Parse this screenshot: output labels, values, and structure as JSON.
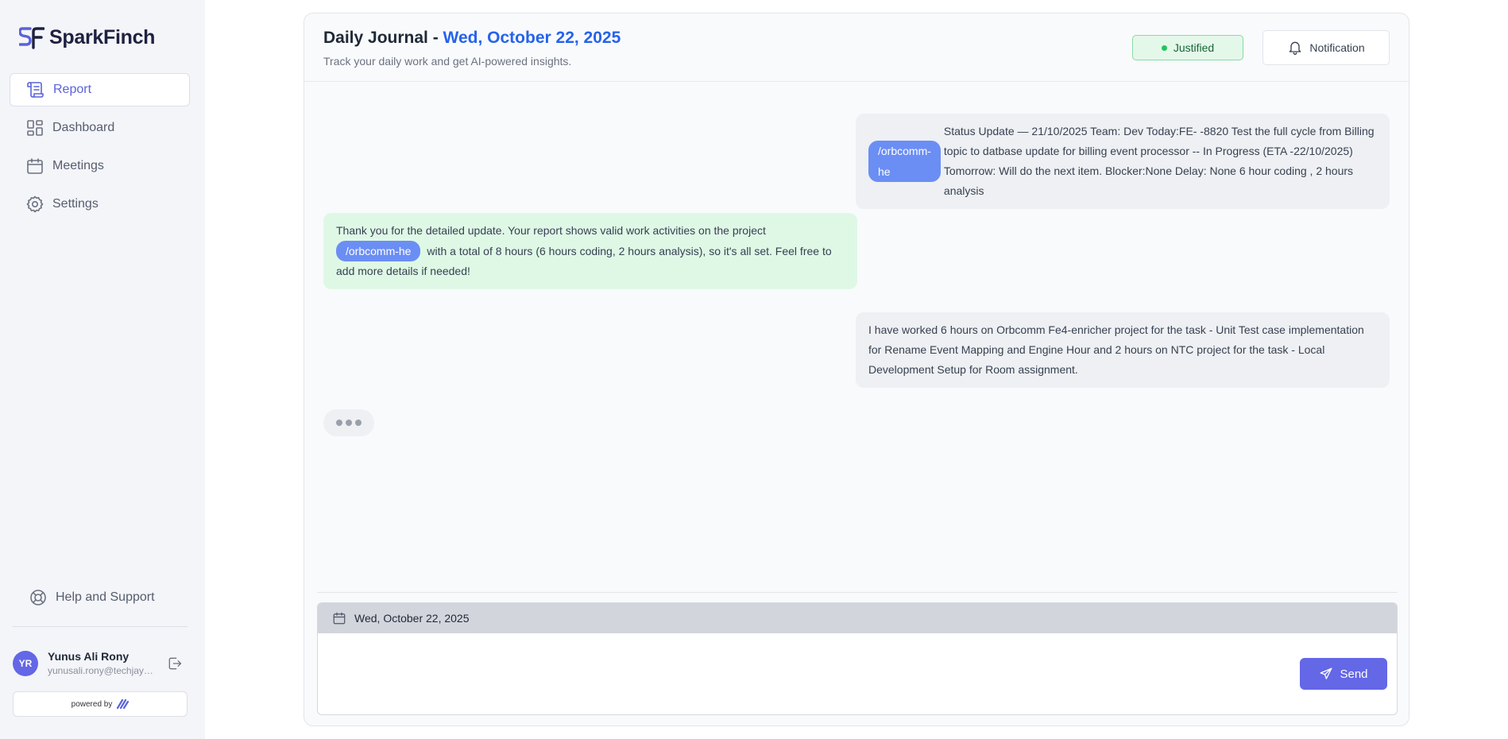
{
  "app": {
    "name": "SparkFinch"
  },
  "sidebar": {
    "items": [
      {
        "label": "Report",
        "icon": "scroll-icon",
        "active": true
      },
      {
        "label": "Dashboard",
        "icon": "dashboard-icon"
      },
      {
        "label": "Meetings",
        "icon": "calendar-icon"
      },
      {
        "label": "Settings",
        "icon": "gear-icon"
      }
    ],
    "help_label": "Help and Support"
  },
  "user": {
    "initials": "YR",
    "name": "Yunus Ali Rony",
    "email": "yunusali.rony@techjays...."
  },
  "powered_by": "powered by",
  "header": {
    "title_prefix": "Daily Journal - ",
    "title_date": "Wed, October 22, 2025",
    "subtitle": "Track your daily work and get AI-powered insights.",
    "status_badge": "Justified",
    "notification_label": "Notification"
  },
  "messages": [
    {
      "role": "user",
      "tag": "/orbcomm-he",
      "text": "Status Update — 21/10/2025 Team: Dev Today:FE- -8820 Test the full cycle from Billing topic to datbase update for billing event processor -- In Progress (ETA -22/10/2025) Tomorrow: Will do the next item. Blocker:None Delay: None 6 hour coding , 2 hours analysis"
    },
    {
      "role": "assistant",
      "text_before": "Thank you for the detailed update. Your report shows valid work activities on the project",
      "tag": "/orbcomm-he",
      "text_after": "with a total of 8 hours (6 hours coding, 2 hours analysis), so it's all set. Feel free to add more details if needed!"
    },
    {
      "role": "user",
      "text": "I have worked 6 hours on Orbcomm Fe4-enricher project for the task - Unit Test case implementation for Rename Event Mapping and Engine Hour and 2 hours on NTC project for the task - Local Development Setup for Room assignment."
    }
  ],
  "composer": {
    "date": "Wed, October 22, 2025",
    "placeholder": "",
    "send_label": "Send"
  },
  "colors": {
    "accent": "#6467e6",
    "title_date": "#2563eb",
    "tag": "#6b8ef5",
    "bot_bubble": "#dff8e6",
    "user_bubble": "#eef0f3"
  }
}
